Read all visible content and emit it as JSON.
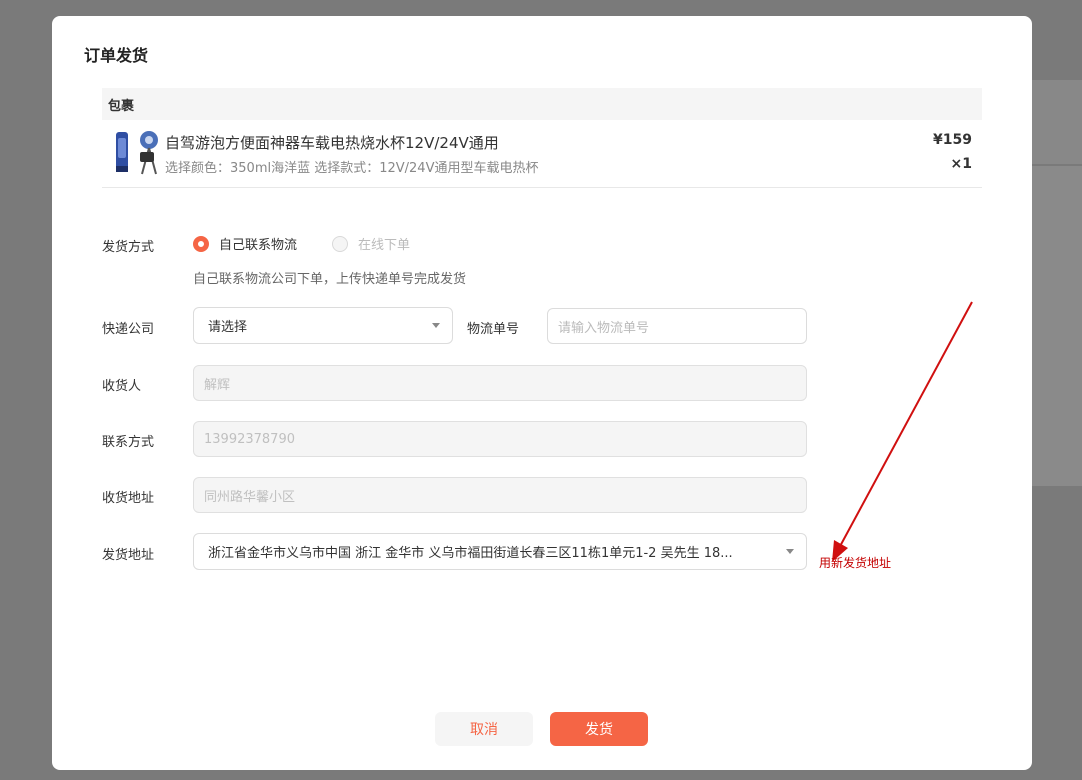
{
  "dialog": {
    "title": "订单发货"
  },
  "package": {
    "header": "包裹",
    "product": {
      "name": "自驾游泡方便面神器车载电热烧水杯12V/24V通用",
      "spec": "选择颜色：350ml海洋蓝  选择款式：12V/24V通用型车载电热杯",
      "price": "¥159",
      "qty": "×1"
    }
  },
  "form": {
    "ship_method": {
      "label": "发货方式",
      "options": [
        "自己联系物流",
        "在线下单"
      ],
      "selected": "自己联系物流",
      "hint": "自己联系物流公司下单，上传快递单号完成发货"
    },
    "courier": {
      "label": "快递公司",
      "value": "请选择"
    },
    "tracking": {
      "label": "物流单号",
      "placeholder": "请输入物流单号"
    },
    "receiver": {
      "label": "收货人",
      "value": "解辉"
    },
    "contact": {
      "label": "联系方式",
      "value": "13992378790"
    },
    "recv_addr": {
      "label": "收货地址",
      "value": "同州路华馨小区"
    },
    "send_addr": {
      "label": "发货地址",
      "value": "浙江省金华市义乌市中国 浙江 金华市 义乌市福田街道长春三区11栋1单元1-2 吴先生 18..."
    }
  },
  "annotation": {
    "text": "用新发货地址",
    "color": "#c40000"
  },
  "buttons": {
    "cancel": "取消",
    "confirm": "发货"
  },
  "colors": {
    "accent": "#f56545"
  }
}
